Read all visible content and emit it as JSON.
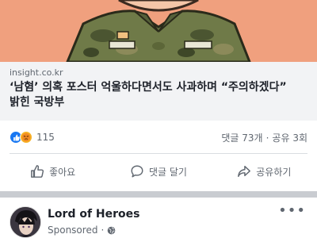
{
  "link_preview": {
    "domain": "insight.co.kr",
    "headline_line1": "‘남혐’ 의혹 포스터 억울하다면서도 사과하며 “주의하겠다”",
    "headline_line2": "밝힌 국방부"
  },
  "reactions": {
    "count": "115",
    "types": [
      "like-icon",
      "angry-icon"
    ]
  },
  "stats": {
    "comments": "댓글 73개",
    "separator": "·",
    "shares": "공유 3회"
  },
  "actions": {
    "like_label": "좋아요",
    "comment_label": "댓글 달기",
    "share_label": "공유하기"
  },
  "next_post": {
    "page_name": "Lord of Heroes",
    "sponsored_label": "Sponsored",
    "separator": "·",
    "more_label": "•••"
  },
  "colors": {
    "accent": "#1877f2",
    "link_bg": "#f2f3f5",
    "thumbnail_bg": "#f0a07e",
    "muted_text": "#606770"
  }
}
